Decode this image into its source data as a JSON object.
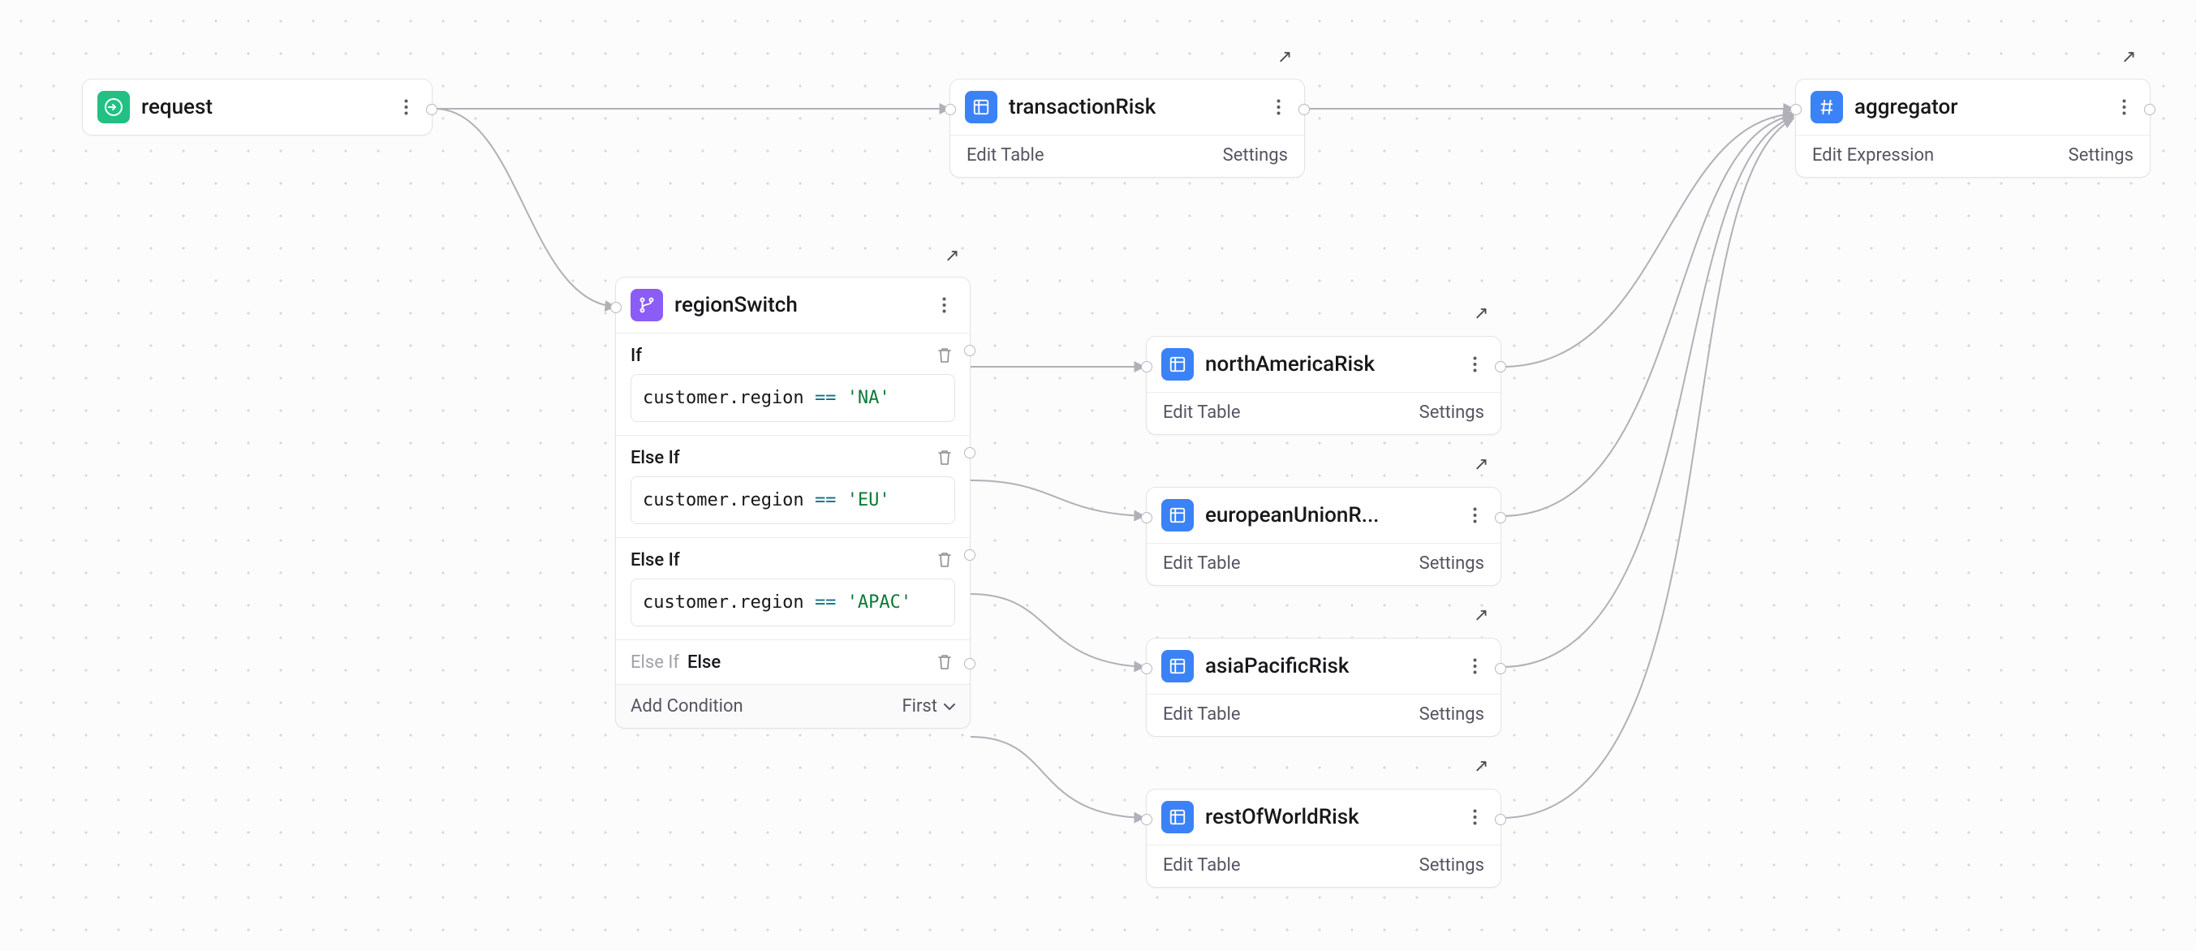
{
  "nodes": {
    "request": {
      "title": "request"
    },
    "transactionRisk": {
      "title": "transactionRisk",
      "leftAction": "Edit Table",
      "rightAction": "Settings"
    },
    "aggregator": {
      "title": "aggregator",
      "leftAction": "Edit Expression",
      "rightAction": "Settings"
    },
    "regionSwitch": {
      "title": "regionSwitch",
      "conditions": [
        {
          "label": "If",
          "field": "customer.region",
          "op": "==",
          "value": "'NA'"
        },
        {
          "label": "Else If",
          "field": "customer.region",
          "op": "==",
          "value": "'EU'"
        },
        {
          "label": "Else If",
          "field": "customer.region",
          "op": "==",
          "value": "'APAC'"
        }
      ],
      "elseLabelDim": "Else If",
      "elseLabel": "Else",
      "addCondition": "Add Condition",
      "hitPolicy": "First"
    },
    "northAmericaRisk": {
      "title": "northAmericaRisk",
      "leftAction": "Edit Table",
      "rightAction": "Settings"
    },
    "europeanUnionRisk": {
      "title": "europeanUnionR...",
      "leftAction": "Edit Table",
      "rightAction": "Settings"
    },
    "asiaPacificRisk": {
      "title": "asiaPacificRisk",
      "leftAction": "Edit Table",
      "rightAction": "Settings"
    },
    "restOfWorldRisk": {
      "title": "restOfWorldRisk",
      "leftAction": "Edit Table",
      "rightAction": "Settings"
    }
  }
}
